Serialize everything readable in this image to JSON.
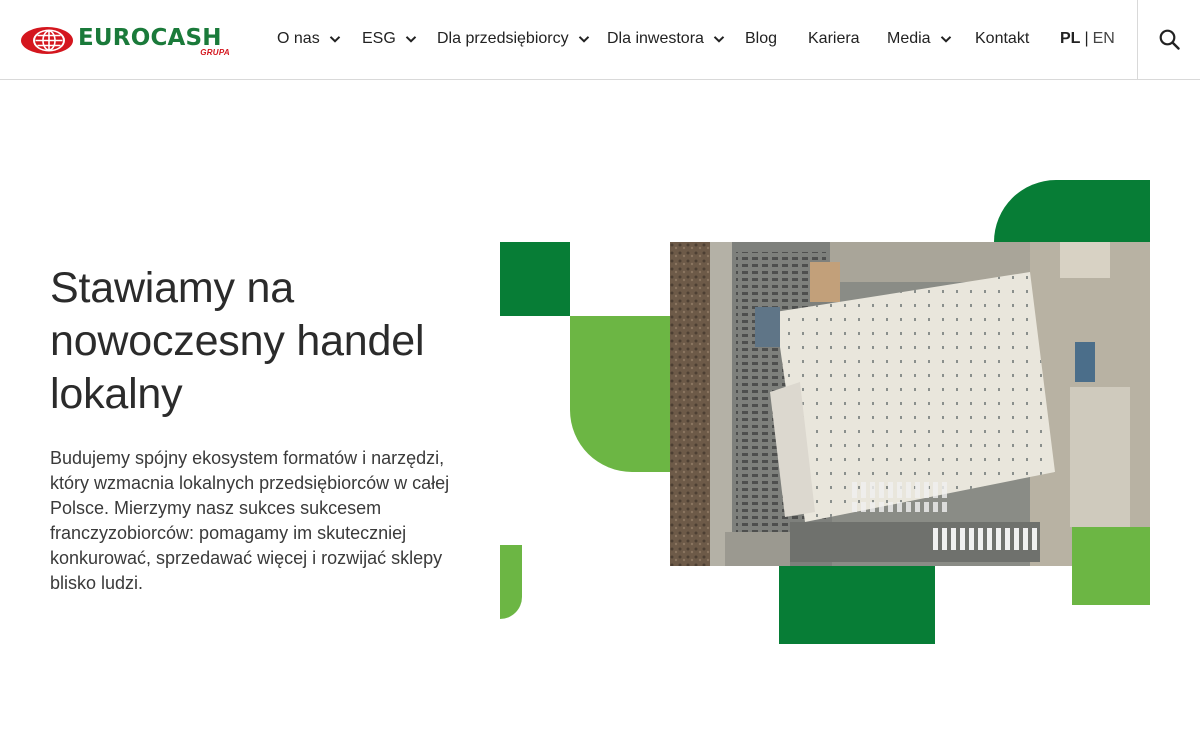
{
  "header": {
    "logo": {
      "wordmark": "EUROCASH",
      "subtitle": "GRUPA"
    },
    "nav": [
      {
        "label": "O nas",
        "has_dropdown": true
      },
      {
        "label": "ESG",
        "has_dropdown": true
      },
      {
        "label": "Dla przedsiębiorcy",
        "has_dropdown": true
      },
      {
        "label": "Dla inwestora",
        "has_dropdown": true
      },
      {
        "label": "Blog",
        "has_dropdown": false
      },
      {
        "label": "Kariera",
        "has_dropdown": false
      },
      {
        "label": "Media",
        "has_dropdown": true
      },
      {
        "label": "Kontakt",
        "has_dropdown": false
      }
    ],
    "language": {
      "active": "PL",
      "separator": "|",
      "other": "EN"
    },
    "search_icon": "search-icon"
  },
  "hero": {
    "title": "Stawiamy na nowoczesny handel lokalny",
    "description": "Budujemy spójny ekosystem formatów i narzędzi, który wzmacnia lokalnych przedsiębiorców w całej Polsce. Mierzymy nasz sukces sukcesem franczyzobiorców: pomagamy im skuteczniej konkurować, sprzedawać więcej i rozwijać sklepy blisko ludzi."
  },
  "colors": {
    "brand_dark_green": "#077d36",
    "brand_light_green": "#6cb644",
    "logo_red": "#d4161e",
    "border": "#d9d9d9"
  }
}
